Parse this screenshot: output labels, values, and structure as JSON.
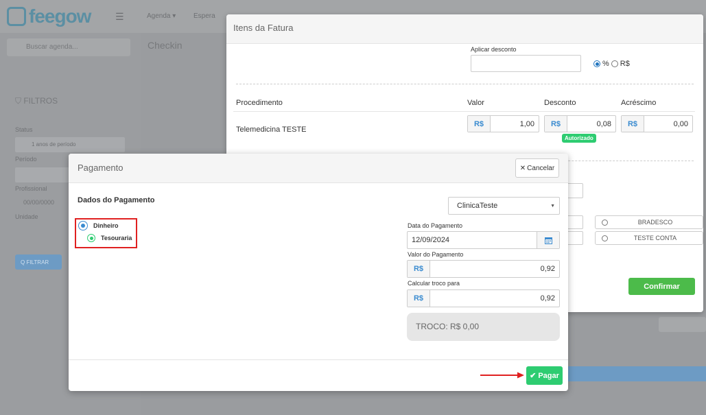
{
  "background": {
    "logo_text": "feegow",
    "nav": [
      "Agenda ▾",
      "Espera"
    ],
    "search_placeholder": "Buscar agenda...",
    "filter_label": "FILTROS",
    "page_title": "Checkin",
    "labels": [
      "Status",
      "Período",
      "Profissional",
      "Unidade"
    ],
    "field_values": [
      "1 anos de período",
      "",
      "00/00/0000",
      ""
    ],
    "side_button": "Q FILTRAR"
  },
  "fatura": {
    "title": "Itens da Fatura",
    "discount_label": "Aplicar desconto",
    "discount_value": "",
    "discount_options": [
      "%",
      "R$"
    ],
    "columns": [
      "Procedimento",
      "Valor",
      "Desconto",
      "Acréscimo"
    ],
    "row": {
      "procedure": "Telemedicina TESTE",
      "currency": "R$",
      "valor": "1,00",
      "desconto": "0,08",
      "acrescimo": "0,00",
      "badge": "Autorizado"
    },
    "banks": [
      "BRADESCO",
      "TESTE CONTA"
    ],
    "confirm_label": "Confirmar"
  },
  "pagamento": {
    "title": "Pagamento",
    "cancel_label": "Cancelar",
    "section_title": "Dados do Pagamento",
    "clinic": "ClinicaTeste",
    "methods": {
      "primary": "Dinheiro",
      "secondary": "Tesouraria"
    },
    "date_label": "Data do Pagamento",
    "date_value": "12/09/2024",
    "valor_label": "Valor do Pagamento",
    "currency": "R$",
    "valor_value": "0,92",
    "troco_label": "Calcular troco para",
    "troco_input": "0,92",
    "troco_text": "TROCO: R$ 0,00",
    "pay_label": "Pagar"
  },
  "colors": {
    "primary_blue": "#3a8bd0",
    "success_green": "#2ecc71",
    "confirm_green": "#4cbb4a",
    "highlight_red": "#e02020"
  }
}
